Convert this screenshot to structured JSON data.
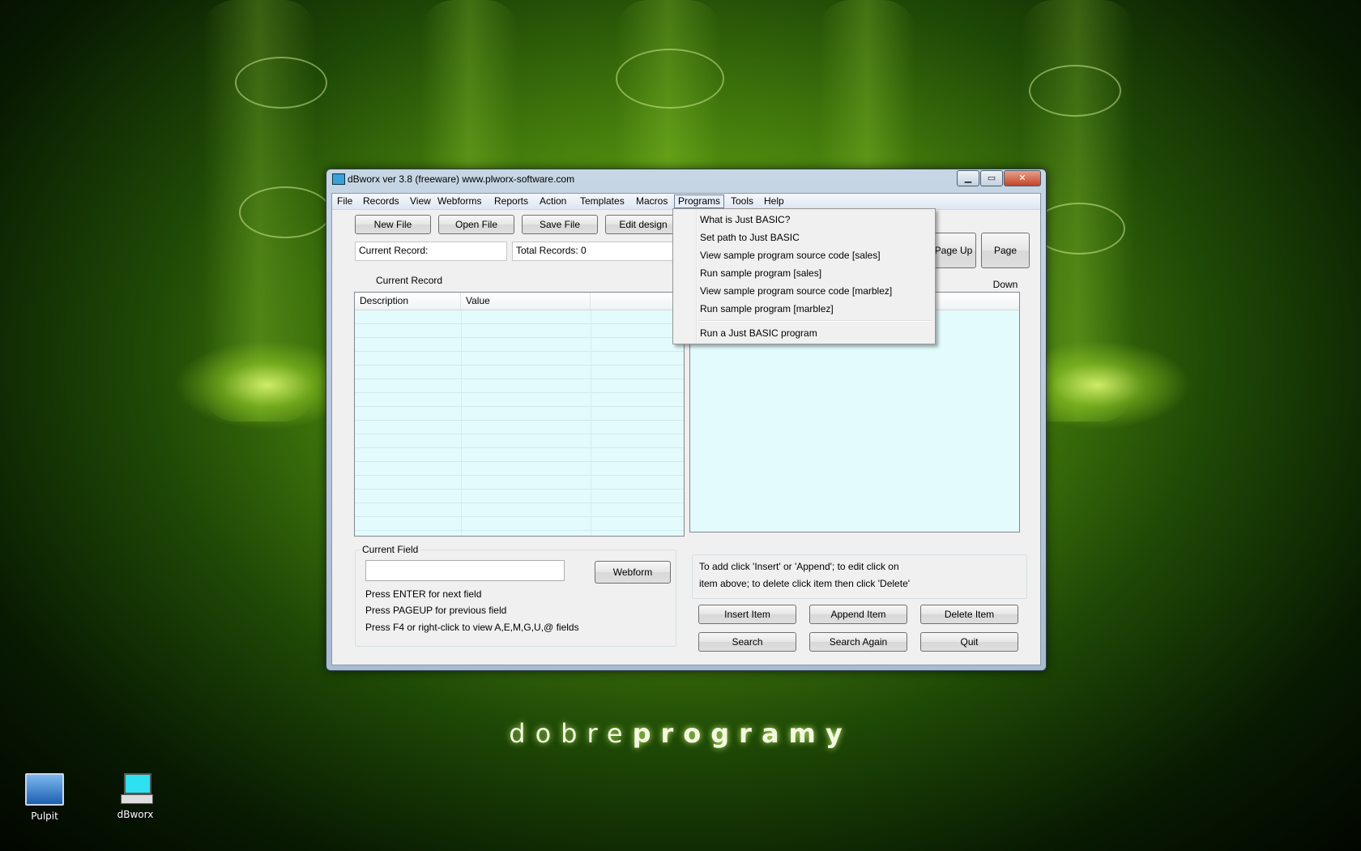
{
  "desktop": {
    "brand_light": "dobre",
    "brand_bold": "programy",
    "icons": [
      {
        "label": "Pulpit",
        "icon": "monitor-icon"
      },
      {
        "label": "dBworx",
        "icon": "computer-icon"
      }
    ],
    "colors": {
      "background": "#3f7a0c",
      "glow": "#c8f050"
    }
  },
  "window": {
    "title": "dBworx ver 3.8 (freeware)   www.plworx-software.com",
    "controls": {
      "minimize": "▁",
      "maximize": "▭",
      "close": "✕"
    }
  },
  "menubar": {
    "items": [
      "File",
      "Records",
      "View",
      "Webforms",
      "Reports",
      "Action",
      "Templates",
      "Macros",
      "Programs",
      "Tools",
      "Help"
    ],
    "active": "Programs"
  },
  "toolbar": {
    "new_file": "New File",
    "open_file": "Open File",
    "save_file": "Save File",
    "edit_design": "Edit design",
    "page_up": "Page Up",
    "page_down": "Page Down"
  },
  "status": {
    "current_record_label": "Current Record:",
    "total_records_label": "Total Records: 0"
  },
  "current_record_panel": {
    "title": "Current Record",
    "columns": [
      "Description",
      "Value",
      ""
    ]
  },
  "current_field": {
    "title": "Current Field",
    "input_value": "",
    "webform_button": "Webform",
    "hints": [
      "Press ENTER for next field",
      "Press PAGEUP for previous field",
      "Press F4 or right-click to view A,E,M,G,U,@ fields"
    ]
  },
  "instructions": {
    "line1": "To add click 'Insert' or 'Append'; to edit click on",
    "line2": "item above; to delete click item then click 'Delete'"
  },
  "actions": {
    "insert": "Insert Item",
    "append": "Append Item",
    "delete": "Delete Item",
    "search": "Search",
    "search_again": "Search Again",
    "quit": "Quit"
  },
  "programs_menu": {
    "items": [
      "What is Just BASIC?",
      "Set path to Just BASIC",
      "View sample program source code [sales]",
      "Run sample program [sales]",
      "View sample program source code [marblez]",
      "Run sample program [marblez]",
      "Run a Just BASIC program"
    ]
  }
}
